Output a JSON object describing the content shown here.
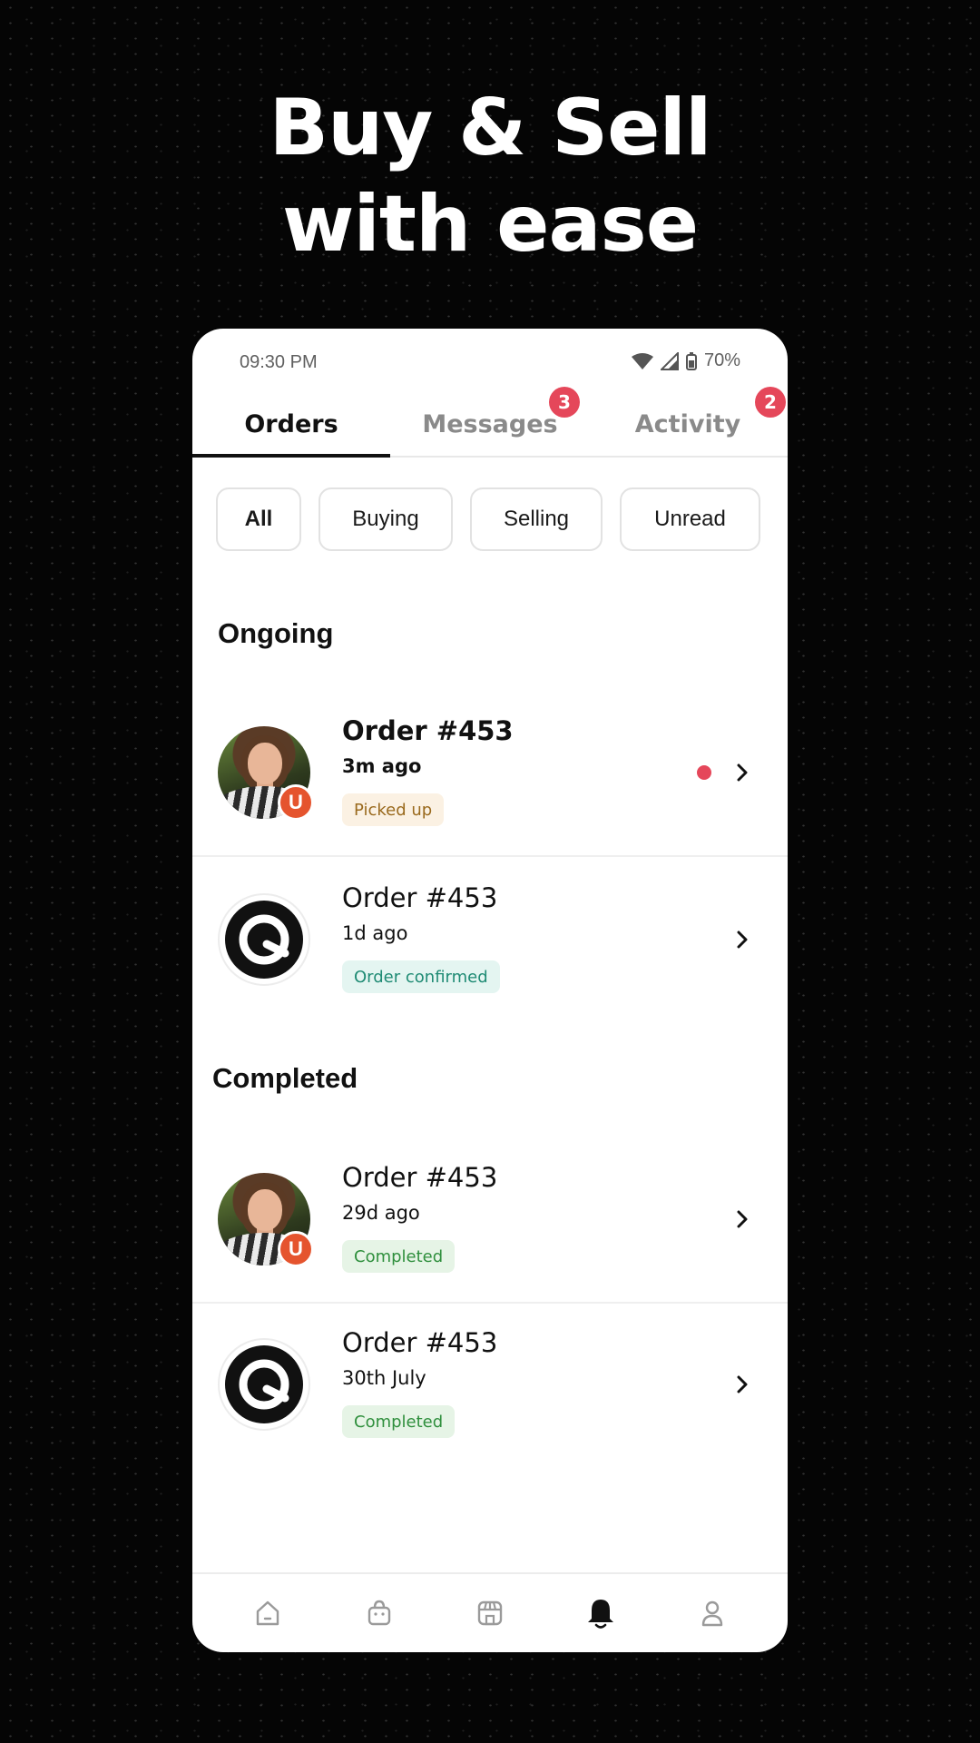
{
  "headline": {
    "line1": "Buy & Sell",
    "line2": "with ease"
  },
  "status_bar": {
    "time": "09:30 PM",
    "battery": "70%"
  },
  "tabs": [
    {
      "label": "Orders",
      "active": true
    },
    {
      "label": "Messages",
      "badge": "3"
    },
    {
      "label": "Activity",
      "badge": "2"
    }
  ],
  "filters": [
    {
      "label": "All",
      "active": true
    },
    {
      "label": "Buying"
    },
    {
      "label": "Selling"
    },
    {
      "label": "Unread"
    }
  ],
  "sections": {
    "ongoing_title": "Ongoing",
    "completed_title": "Completed"
  },
  "orders": [
    {
      "title": "Order #453",
      "time": "3m ago",
      "status": "Picked up",
      "avatar": "user-photo-icon",
      "seller_badge": "U",
      "unread": true
    },
    {
      "title": "Order #453",
      "time": "1d ago",
      "status": "Order confirmed",
      "avatar": "q-logo-icon"
    },
    {
      "title": "Order #453",
      "time": "29d ago",
      "status": "Completed",
      "avatar": "user-photo-icon",
      "seller_badge": "U"
    },
    {
      "title": "Order #453",
      "time": "30th July",
      "status": "Completed",
      "avatar": "q-logo-icon"
    }
  ],
  "bottom_nav": [
    "home-icon",
    "bag-icon",
    "store-icon",
    "bell-icon",
    "profile-icon"
  ],
  "colors": {
    "badge": "#e5475a",
    "seller_badge": "#e5542e",
    "accent": "#111111"
  }
}
